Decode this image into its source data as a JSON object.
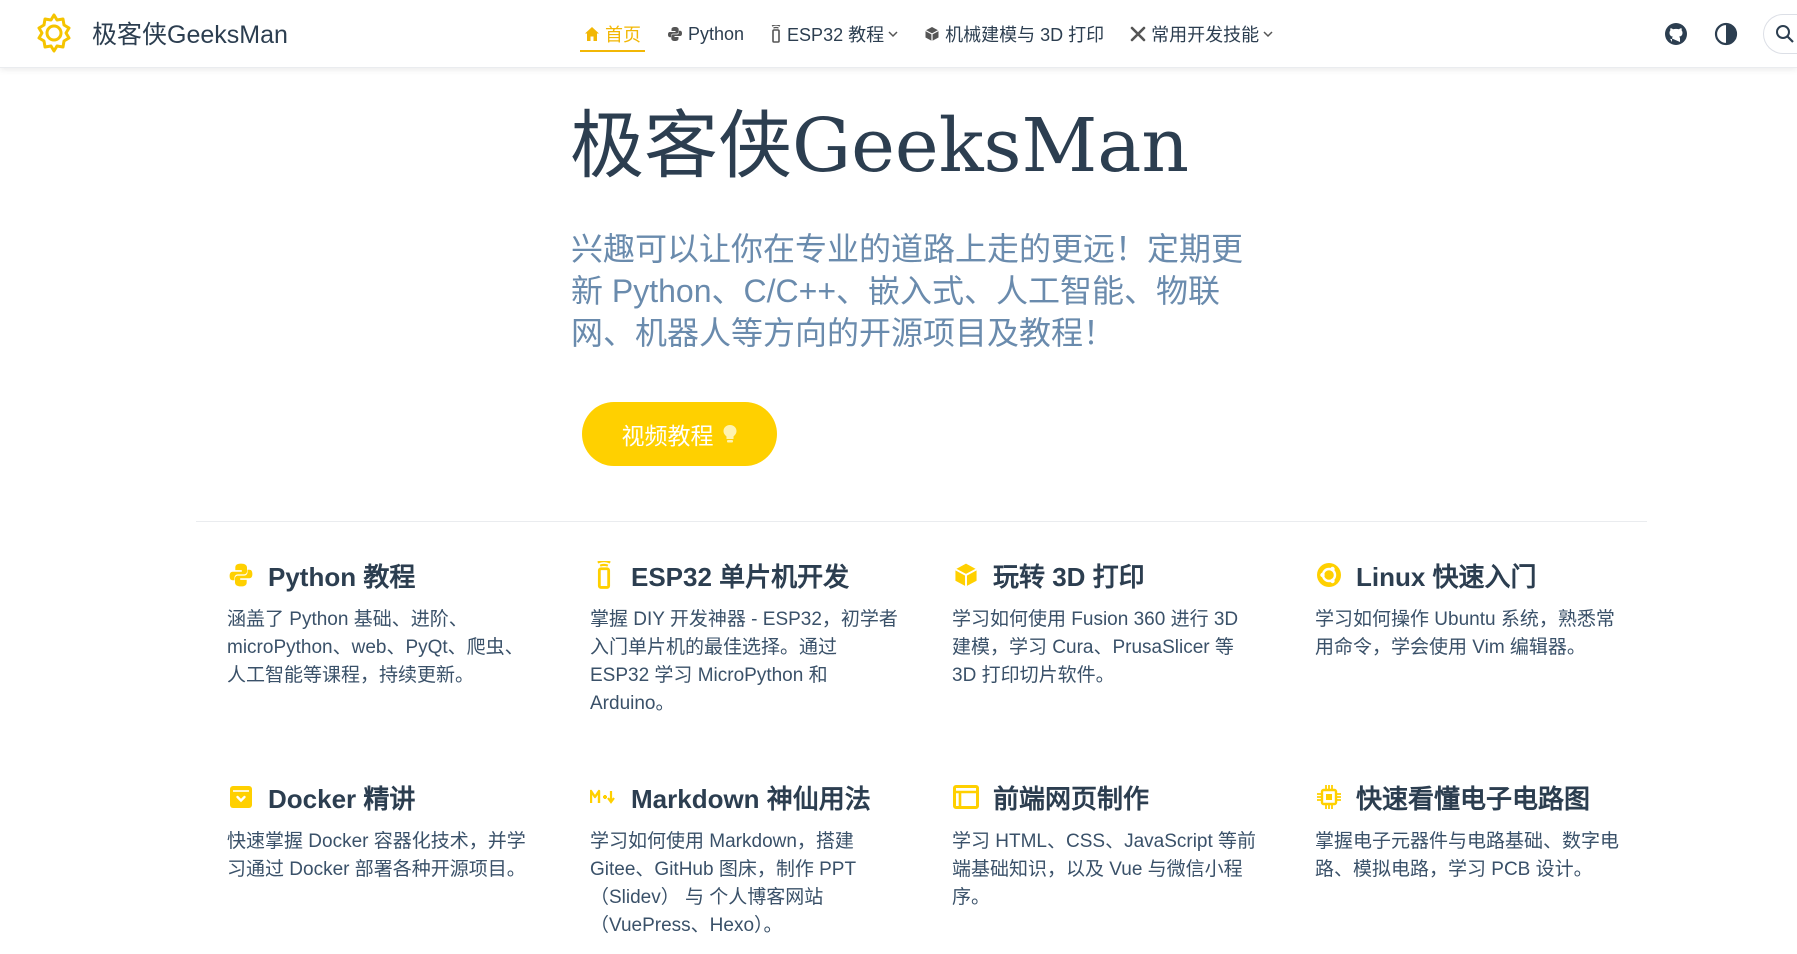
{
  "colors": {
    "accent": "#ffd000",
    "active": "#f2b705",
    "text": "#2c3e50",
    "tagline": "#6a8bad"
  },
  "navbar": {
    "site_name": "极客侠GeeksMan",
    "logo_icon": "gear-icon",
    "items": [
      {
        "label": "首页",
        "icon": "home-icon",
        "active": true
      },
      {
        "label": "Python",
        "icon": "python-icon"
      },
      {
        "label": "ESP32 教程",
        "icon": "microcontroller-icon",
        "dropdown": true
      },
      {
        "label": "机械建模与 3D 打印",
        "icon": "cube-icon"
      },
      {
        "label": "常用开发技能",
        "icon": "tools-icon",
        "dropdown": true
      }
    ],
    "tools": [
      "github-icon",
      "theme-toggle-icon",
      "search-icon"
    ]
  },
  "hero": {
    "title": "极客侠GeeksMan",
    "tagline": "兴趣可以让你在专业的道路上走的更远！定期更新 Python、C/C++、嵌入式、人工智能、物联网、机器人等方向的开源项目及教程！",
    "action": "视频教程",
    "action_icon": "lightbulb-icon"
  },
  "features": [
    {
      "title": "Python 教程",
      "icon": "python-icon",
      "desc": "涵盖了 Python 基础、进阶、microPython、web、PyQt、爬虫、人工智能等课程，持续更新。"
    },
    {
      "title": "ESP32 单片机开发",
      "icon": "microcontroller-icon",
      "desc": "掌握 DIY 开发神器 - ESP32，初学者入门单片机的最佳选择。通过 ESP32 学习 MicroPython 和 Arduino。"
    },
    {
      "title": "玩转 3D 打印",
      "icon": "cube-icon",
      "desc": "学习如何使用 Fusion 360 进行 3D 建模，学习 Cura、PrusaSlicer 等 3D 打印切片软件。"
    },
    {
      "title": "Linux 快速入门",
      "icon": "ubuntu-icon",
      "desc": "学习如何操作 Ubuntu 系统，熟悉常用命令，学会使用 Vim 编辑器。"
    },
    {
      "title": "Docker 精讲",
      "icon": "docker-icon",
      "desc": "快速掌握 Docker 容器化技术，并学习通过 Docker 部署各种开源项目。"
    },
    {
      "title": "Markdown 神仙用法",
      "icon": "markdown-icon",
      "desc": "学习如何使用 Markdown，搭建 Gitee、GitHub 图床，制作 PPT（Slidev） 与 个人博客网站（VuePress、Hexo）。"
    },
    {
      "title": "前端网页制作",
      "icon": "browser-window-icon",
      "desc": "学习 HTML、CSS、JavaScript 等前端基础知识，以及 Vue 与微信小程序。"
    },
    {
      "title": "快速看懂电子电路图",
      "icon": "chip-icon",
      "desc": "掌握电子元器件与电路基础、数字电路、模拟电路，学习 PCB 设计。"
    }
  ]
}
